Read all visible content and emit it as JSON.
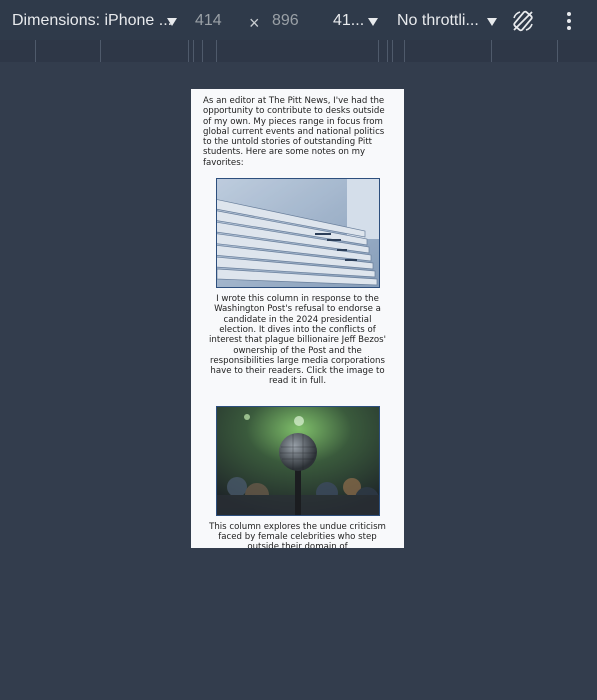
{
  "toolbar": {
    "dimensions_label": "Dimensions: iPhone ...",
    "width_value": "414",
    "times_symbol": "×",
    "height_value": "896",
    "zoom_label": "41...",
    "throttle_label": "No throttli...",
    "icons": {
      "caret": "chevron-down-icon",
      "rotate": "rotate-icon",
      "more": "more-vertical-icon"
    }
  },
  "page": {
    "intro": "As an editor at The Pitt News, I've had the opportunity to contribute to desks outside of my own. My pieces range in focus from global current events and national politics to the untold stories of outstanding Pitt students. Here are some notes on my favorites:",
    "cards": [
      {
        "image": "newspapers-photo",
        "caption": "I wrote this column in response to the Washington Post's refusal to endorse a candidate in the 2024 presidential election. It dives into the conflicts of interest that plague billionaire Jeff Bezos' ownership of the Post and the responsibilities large media corporations have to their readers. Click the image to read it in full."
      },
      {
        "image": "microphone-photo",
        "caption": "This column explores the undue criticism faced by female celebrities who step outside their domain of"
      }
    ]
  },
  "colors": {
    "background": "#333d4d",
    "toolbar": "#2f3a4a",
    "page": "#f8f9fb",
    "image_border": "#2d4f7d"
  }
}
